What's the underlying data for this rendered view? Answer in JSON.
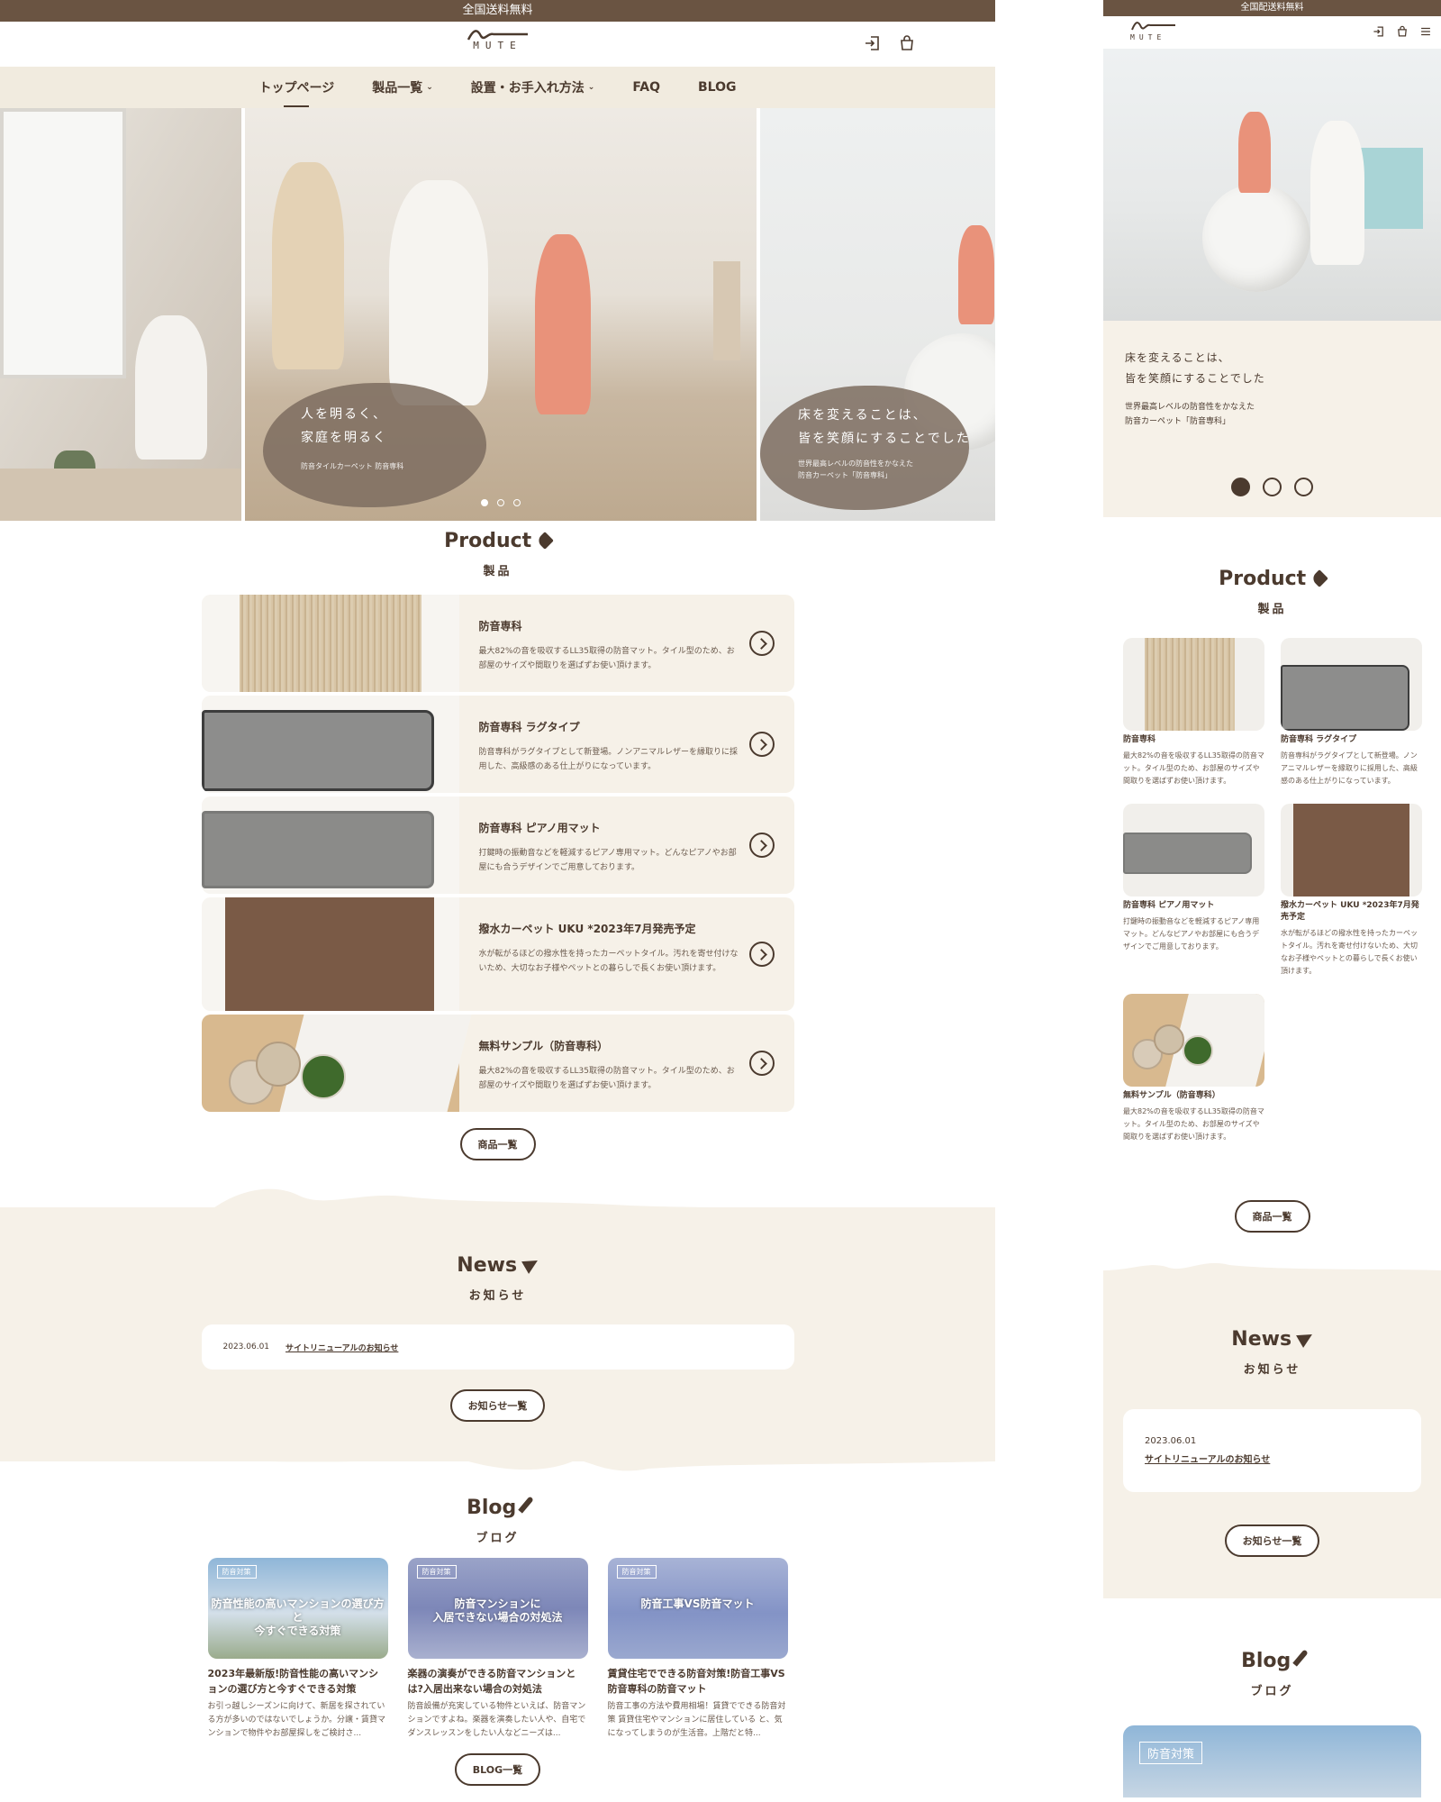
{
  "banner": "全国送料無料",
  "mobile_banner": "全国配送料無料",
  "brand": "MUTE",
  "nav": [
    "トップページ",
    "製品一覧",
    "設置・お手入れ方法",
    "FAQ",
    "BLOG"
  ],
  "hero": {
    "left_copy": {
      "l1": "人を明るく、",
      "l2": "家庭を明るく",
      "sub": "防音タイルカーペット 防音専科"
    },
    "right_copy": {
      "l1": "床を変えることは、",
      "l2": "皆を笑顔にすることでした",
      "sub1": "世界最高レベルの防音性をかなえた",
      "sub2": "防音カーペット「防音専科」"
    }
  },
  "product": {
    "en": "Product",
    "jp": "製品",
    "items": [
      {
        "title": "防音専科",
        "desc": "最大82%の音を吸収するLL35取得の防音マット。タイル型のため、お部屋のサイズや間取りを選ばずお使い頂けます。"
      },
      {
        "title": "防音専科 ラグタイプ",
        "desc": "防音専科がラグタイプとして新登場。ノンアニマルレザーを縁取りに採用した、高級感のある仕上がりになっています。"
      },
      {
        "title": "防音専科 ピアノ用マット",
        "desc": "打鍵時の振動音などを軽減するピアノ専用マット。どんなピアノやお部屋にも合うデザインでご用意しております。"
      },
      {
        "title": "撥水カーペット UKU *2023年7月発売予定",
        "desc": "水が転がるほどの撥水性を持ったカーペットタイル。汚れを寄せ付けないため、大切なお子様やペットとの暮らしで長くお使い頂けます。"
      },
      {
        "title": "無料サンプル（防音専科）",
        "desc": "最大82%の音を吸収するLL35取得の防音マット。タイル型のため、お部屋のサイズや間取りを選ばずお使い頂けます。"
      }
    ],
    "button": "商品一覧"
  },
  "news": {
    "en": "News",
    "jp": "お知らせ",
    "date": "2023.06.01",
    "link": "サイトリニューアルのお知らせ",
    "button": "お知らせ一覧"
  },
  "blog": {
    "en": "Blog",
    "jp": "ブログ",
    "tag": "防音対策",
    "posts": [
      {
        "cap1": "防音性能の高いマンションの選び方と",
        "cap2": "今すぐできる対策",
        "title": "2023年最新版!防音性能の高いマンションの選び方と今すぐできる対策",
        "desc": "お引っ越しシーズンに向けて、新居を探されている方が多いのではないでしょうか。分譲・賃貸マンションで物件やお部屋探しをご検討さ..."
      },
      {
        "cap1": "防音マンションに",
        "cap2": "入居できない場合の対処法",
        "title": "楽器の演奏ができる防音マンションとは?入居出来ない場合の対処法",
        "desc": "防音設備が充実している物件といえば、防音マンションですよね。楽器を演奏したい人や、自宅でダンスレッスンをしたい人などニーズは..."
      },
      {
        "cap1": "防音工事VS防音マット",
        "cap2": "",
        "title": "賃貸住宅でできる防音対策!防音工事VS防音専科の防音マット",
        "desc": "防音工事の方法や費用相場！賃貸でできる防音対策 賃貸住宅やマンションに居住している と、気になってしまうのが生活音。上階だと特..."
      }
    ],
    "button": "BLOG一覧"
  },
  "colors": {
    "brand_brown": "#6a5442",
    "beige": "#f6f1e8",
    "text": "#4b3a2e"
  }
}
